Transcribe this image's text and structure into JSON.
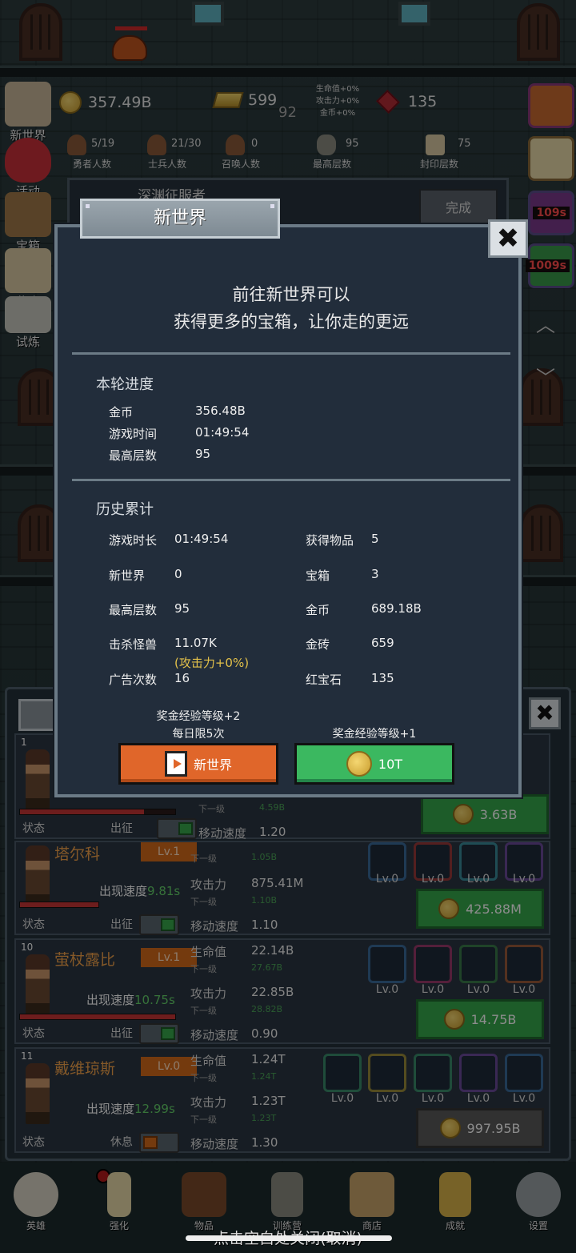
{
  "top": {
    "gold": "357.49B",
    "gold_bars": "599",
    "stage_num": "92",
    "bonus_hp": "生命值+0%",
    "bonus_atk": "攻击力+0%",
    "bonus_gold": "金币+0%",
    "rubies": "135",
    "stats": [
      {
        "value": "5/19",
        "label": "勇者人数"
      },
      {
        "value": "21/30",
        "label": "士兵人数"
      },
      {
        "value": "0",
        "label": "召唤人数"
      },
      {
        "value": "95",
        "label": "最高层数"
      },
      {
        "value": "75",
        "label": "封印层数"
      }
    ]
  },
  "left_menu": [
    "新世界",
    "活动",
    "宝箱",
    "奖金",
    "试炼"
  ],
  "right_timers": [
    "109s",
    "1009s"
  ],
  "quest": {
    "title": "深渊征服者",
    "button": "完成"
  },
  "dialog": {
    "title": "新世界",
    "close": "✖",
    "intro_line1": "前往新世界可以",
    "intro_line2": "获得更多的宝箱，让你走的更远",
    "round_title": "本轮进度",
    "round": [
      {
        "k": "金币",
        "v": "356.48B"
      },
      {
        "k": "游戏时间",
        "v": "01:49:54"
      },
      {
        "k": "最高层数",
        "v": "95"
      }
    ],
    "history_title": "历史累计",
    "history_left": [
      {
        "k": "游戏时长",
        "v": "01:49:54"
      },
      {
        "k": "新世界",
        "v": "0"
      },
      {
        "k": "最高层数",
        "v": "95"
      },
      {
        "k": "击杀怪兽",
        "v": "11.07K"
      },
      {
        "k": "广告次数",
        "v": "16"
      }
    ],
    "kill_bonus": "(攻击力+0%)",
    "history_right": [
      {
        "k": "获得物品",
        "v": "5"
      },
      {
        "k": "宝箱",
        "v": "3"
      },
      {
        "k": "金币",
        "v": "689.18B"
      },
      {
        "k": "金砖",
        "v": "659"
      },
      {
        "k": "红宝石",
        "v": "135"
      }
    ],
    "ad_note1": "奖金经验等级+2",
    "ad_note2": "每日限5次",
    "ad_button": "新世界",
    "coin_note": "奖金经验等级+1",
    "coin_button": "10T"
  },
  "heroes": [
    {
      "num": "1",
      "name": "",
      "lv": "",
      "speed": "",
      "status": "状态",
      "deploy": "出征",
      "hp_k": "",
      "hp": "",
      "next1": "下一级",
      "next1v": "4.59B",
      "atk_k": "",
      "atk": "",
      "next2": "",
      "next2v": "",
      "move_k": "移动速度",
      "move": "1.20",
      "skills": [],
      "upgrade": "3.63B",
      "hp_fill": 0.8
    },
    {
      "num": "",
      "name": "塔尔科",
      "lv": "Lv.1",
      "speed_label": "出现速度",
      "speed": "9.81s",
      "status": "状态",
      "deploy": "出征",
      "hp_k": "",
      "hp": "",
      "next1": "下一级",
      "next1v": "1.05B",
      "atk_k": "攻击力",
      "atk": "875.41M",
      "next2": "下一级",
      "next2v": "1.10B",
      "move_k": "移动速度",
      "move": "1.10",
      "skills": [
        "Lv.0",
        "Lv.0",
        "Lv.0",
        "Lv.0"
      ],
      "upgrade": "425.88M",
      "hp_fill": 0.5
    },
    {
      "num": "10",
      "name": "萤杖露比",
      "lv": "Lv.1",
      "speed_label": "出现速度",
      "speed": "10.75s",
      "status": "状态",
      "deploy": "出征",
      "hp_k": "生命值",
      "hp": "22.14B",
      "next1": "下一级",
      "next1v": "27.67B",
      "atk_k": "攻击力",
      "atk": "22.85B",
      "next2": "下一级",
      "next2v": "28.82B",
      "move_k": "移动速度",
      "move": "0.90",
      "skills": [
        "Lv.0",
        "Lv.0",
        "Lv.0",
        "Lv.0"
      ],
      "upgrade": "14.75B",
      "hp_fill": 1.0
    },
    {
      "num": "11",
      "name": "戴维琼斯",
      "lv": "Lv.0",
      "speed_label": "出现速度",
      "speed": "12.99s",
      "status": "状态",
      "deploy": "休息",
      "hp_k": "生命值",
      "hp": "1.24T",
      "next1": "下一级",
      "next1v": "1.24T",
      "atk_k": "攻击力",
      "atk": "1.23T",
      "next2": "下一级",
      "next2v": "1.23T",
      "move_k": "移动速度",
      "move": "1.30",
      "skills": [
        "Lv.0",
        "Lv.0",
        "Lv.0",
        "Lv.0",
        "Lv.0"
      ],
      "upgrade": "997.95B",
      "hp_fill": 0
    }
  ],
  "nav": [
    "英雄",
    "强化",
    "物品",
    "训练营",
    "商店",
    "成就",
    "设置"
  ],
  "hint": "点击空白处关闭(取消)"
}
